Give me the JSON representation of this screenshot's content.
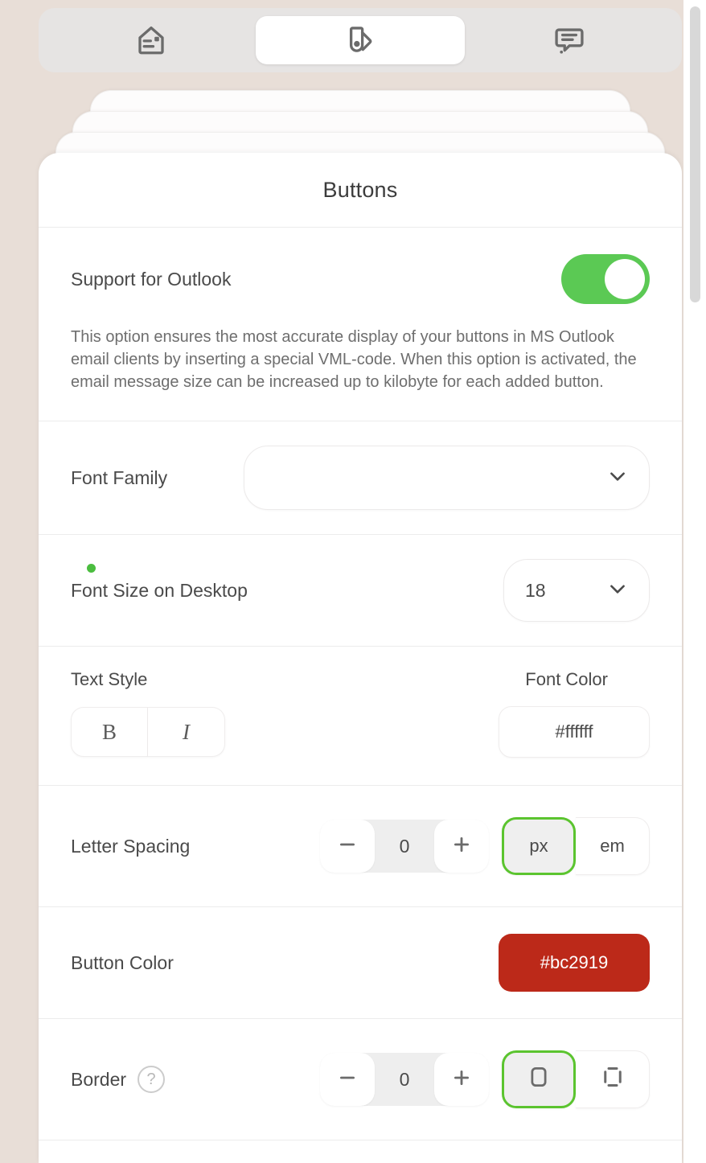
{
  "tabs": [
    {
      "id": "content",
      "icon": "tag-card-icon",
      "active": false
    },
    {
      "id": "design",
      "icon": "palette-icon",
      "active": true
    },
    {
      "id": "comments",
      "icon": "speech-bubble-icon",
      "active": false
    }
  ],
  "panel": {
    "title": "Buttons"
  },
  "outlook": {
    "label": "Support for Outlook",
    "toggle_on": true,
    "description": "This option ensures the most accurate display of your buttons in MS Outlook email clients by inserting a special VML-code. When this option is activated, the email message size can be increased up to kilobyte for each added button."
  },
  "font_family": {
    "label": "Font Family",
    "value": "",
    "placeholder": ""
  },
  "font_size": {
    "label": "Font Size on Desktop",
    "value": "18",
    "has_indicator": true,
    "indicator_color": "#4bbd3f"
  },
  "text_style": {
    "label": "Text Style",
    "bold_label": "B",
    "italic_label": "I"
  },
  "font_color": {
    "label": "Font Color",
    "value": "#ffffff"
  },
  "letter_spacing": {
    "label": "Letter Spacing",
    "value": "0",
    "minus_label": "−",
    "plus_label": "+",
    "units": [
      {
        "label": "px",
        "selected": true
      },
      {
        "label": "em",
        "selected": false
      }
    ]
  },
  "button_color": {
    "label": "Button Color",
    "value": "#bc2919",
    "swatch_color": "#bc2919"
  },
  "border": {
    "label": "Border",
    "help_label": "?",
    "value": "0",
    "minus_label": "−",
    "plus_label": "+",
    "styles": [
      {
        "icon": "rounded-rect-icon",
        "selected": true
      },
      {
        "icon": "dashed-rect-icon",
        "selected": false
      }
    ]
  },
  "theme": {
    "background": "#e8ded7",
    "tabbar_background": "#e6e4e3",
    "card_background": "#ffffff",
    "accent_green": "#5bc954",
    "select_green": "#5bc42f"
  }
}
